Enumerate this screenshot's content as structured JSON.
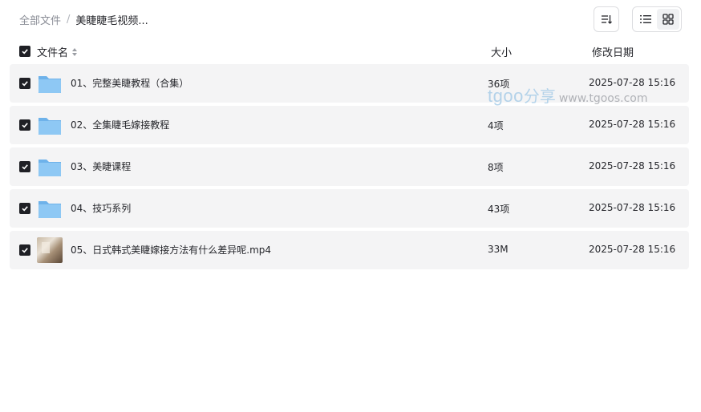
{
  "breadcrumb": {
    "root": "全部文件",
    "separator": "/",
    "current": "美睫睫毛视频..."
  },
  "columns": {
    "name": "文件名",
    "size": "大小",
    "modified": "修改日期"
  },
  "files": [
    {
      "name": "01、完整美睫教程（合集）",
      "size": "36项",
      "modified": "2025-07-28 15:16",
      "type": "folder"
    },
    {
      "name": "02、全集睫毛嫁接教程",
      "size": "4项",
      "modified": "2025-07-28 15:16",
      "type": "folder"
    },
    {
      "name": "03、美睫课程",
      "size": "8项",
      "modified": "2025-07-28 15:16",
      "type": "folder"
    },
    {
      "name": "04、技巧系列",
      "size": "43项",
      "modified": "2025-07-28 15:16",
      "type": "folder"
    },
    {
      "name": "05、日式韩式美睫嫁接方法有什么差异呢.mp4",
      "size": "33M",
      "modified": "2025-07-28 15:16",
      "type": "video"
    }
  ],
  "watermark": {
    "brand": "tgoo",
    "cn": "分享",
    "url": "www.tgoos.com"
  },
  "icons": {
    "sort": "sort-icon",
    "list_view": "list-view-icon",
    "grid_view": "grid-view-icon",
    "folder": "folder-icon",
    "check": "check-icon"
  },
  "colors": {
    "folder": "#7fbdf0",
    "checkbox": "#1f2025",
    "row_bg": "#f4f4f5"
  }
}
